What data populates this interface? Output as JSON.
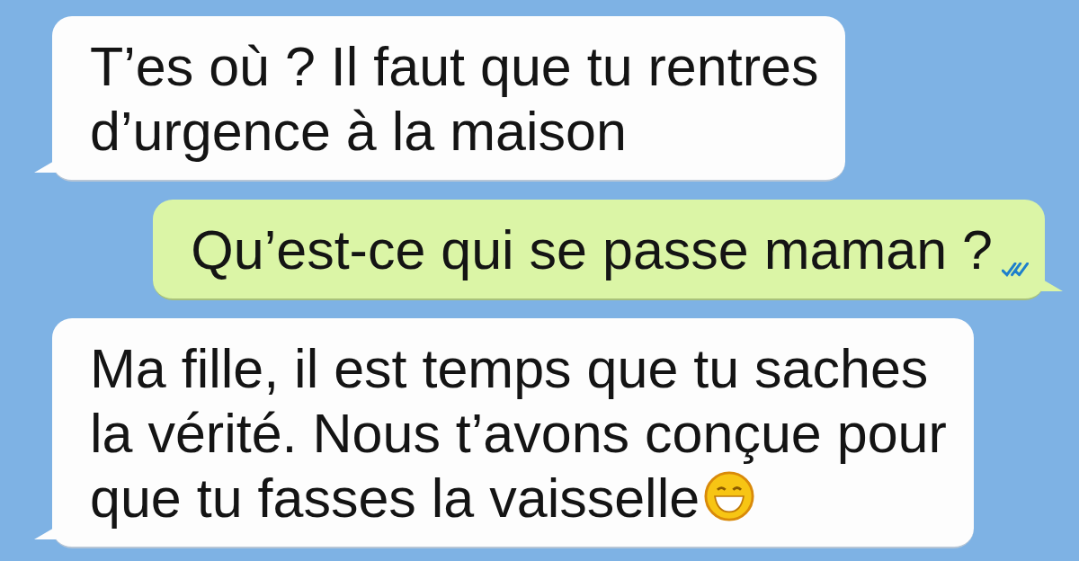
{
  "messages": [
    {
      "kind": "incoming",
      "lines": [
        "T’es où ? Il faut que tu rentres",
        "d’urgence à la maison"
      ]
    },
    {
      "kind": "outgoing",
      "lines": [
        "Qu’est-ce qui se passe maman ?"
      ],
      "read": true
    },
    {
      "kind": "incoming",
      "lines": [
        "Ma fille, il est temps que tu saches",
        "la vérité. Nous t’avons conçue pour",
        "que tu fasses la vaisselle"
      ],
      "emoji": true
    }
  ]
}
